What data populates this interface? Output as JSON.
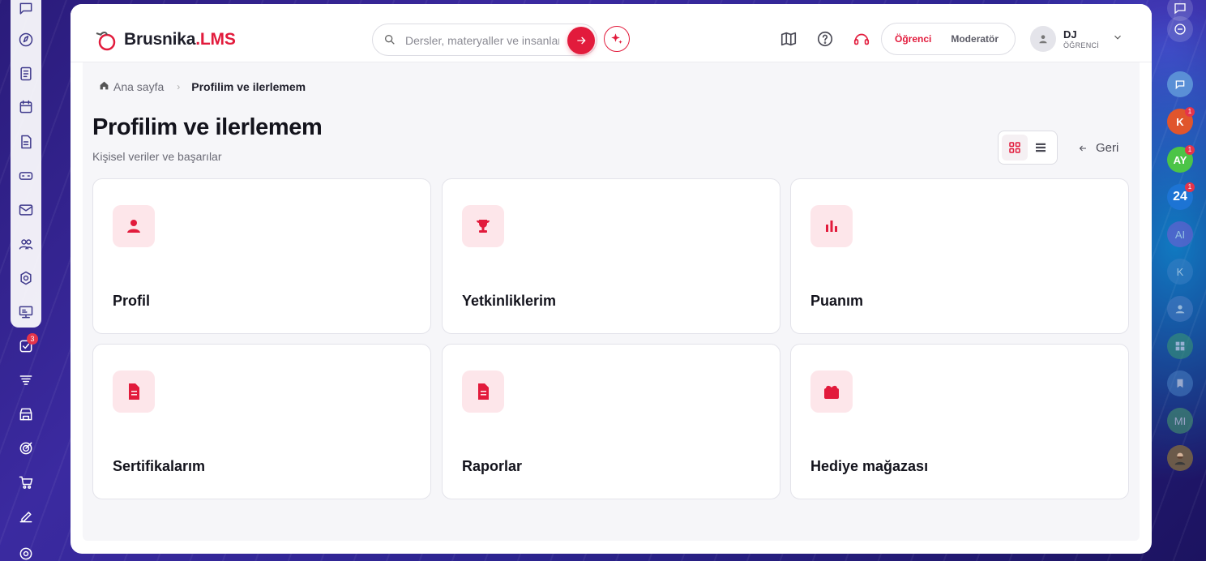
{
  "left_rail": {
    "badges": {
      "tasks": "3"
    }
  },
  "right_rail": {
    "items": [
      {
        "initials": "K",
        "color": "#e0552c",
        "badge": "1"
      },
      {
        "initials": "AY",
        "color": "#4cc447",
        "badge": "1"
      },
      {
        "initials": "24",
        "color": "#1d74d4",
        "badge": "1"
      },
      {
        "initials": "AI",
        "color": "#7b5cd6",
        "badge": ""
      },
      {
        "initials": "K",
        "color": "#3a7fc4",
        "badge": ""
      },
      {
        "initials": "MI",
        "color": "#4b9e6a",
        "badge": ""
      }
    ]
  },
  "header": {
    "logo_main": "Brusnika",
    "logo_accent": ".LMS",
    "search_placeholder": "Dersler, materyaller ve insanlar",
    "roles": {
      "active": "Öğrenci",
      "inactive": "Moderatör"
    },
    "user": {
      "name": "DJ",
      "role": "ÖĞRENCİ"
    }
  },
  "breadcrumb": {
    "home": "Ana sayfa",
    "separator": "›",
    "current": "Profilim ve ilerlemem"
  },
  "page": {
    "title": "Profilim ve ilerlemem",
    "subtitle": "Kişisel veriler ve başarılar",
    "back_label": "Geri"
  },
  "cards": [
    {
      "title": "Profil",
      "icon": "person-icon"
    },
    {
      "title": "Yetkinliklerim",
      "icon": "trophy-icon"
    },
    {
      "title": "Puanım",
      "icon": "bar-chart-icon"
    },
    {
      "title": "Sertifikalarım",
      "icon": "document-icon"
    },
    {
      "title": "Raporlar",
      "icon": "report-icon"
    },
    {
      "title": "Hediye mağazası",
      "icon": "gift-icon"
    }
  ],
  "colors": {
    "accent": "#e21b3c",
    "icon_bg": "#fde6ea",
    "content_bg": "#f6f6f9",
    "rail_icon": "#3f3a8c"
  }
}
